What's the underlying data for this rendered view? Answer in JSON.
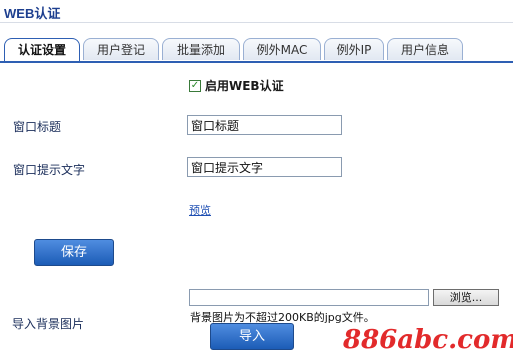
{
  "page": {
    "title": "WEB认证"
  },
  "tabs": [
    {
      "label": "认证设置",
      "active": true
    },
    {
      "label": "用户登记",
      "active": false
    },
    {
      "label": "批量添加",
      "active": false
    },
    {
      "label": "例外MAC",
      "active": false
    },
    {
      "label": "例外IP",
      "active": false
    },
    {
      "label": "用户信息",
      "active": false
    }
  ],
  "form": {
    "enable_checkbox": {
      "label": "启用WEB认证",
      "checked": true
    },
    "window_title": {
      "label": "窗口标题",
      "value": "窗口标题"
    },
    "window_hint": {
      "label": "窗口提示文字",
      "value": "窗口提示文字"
    },
    "preview_link": "预览",
    "save_button": "保存",
    "background_image": {
      "label": "导入背景图片",
      "file_value": "",
      "browse_button": "浏览...",
      "hint": "背景图片为不超过200KB的jpg文件。",
      "import_button": "导入"
    }
  },
  "watermark": {
    "text": "886abc.com"
  },
  "colors": {
    "accent": "#2e5fb3",
    "button": "#1c5cb6",
    "title": "#1d3f8f",
    "watermark": "#e0181a"
  }
}
